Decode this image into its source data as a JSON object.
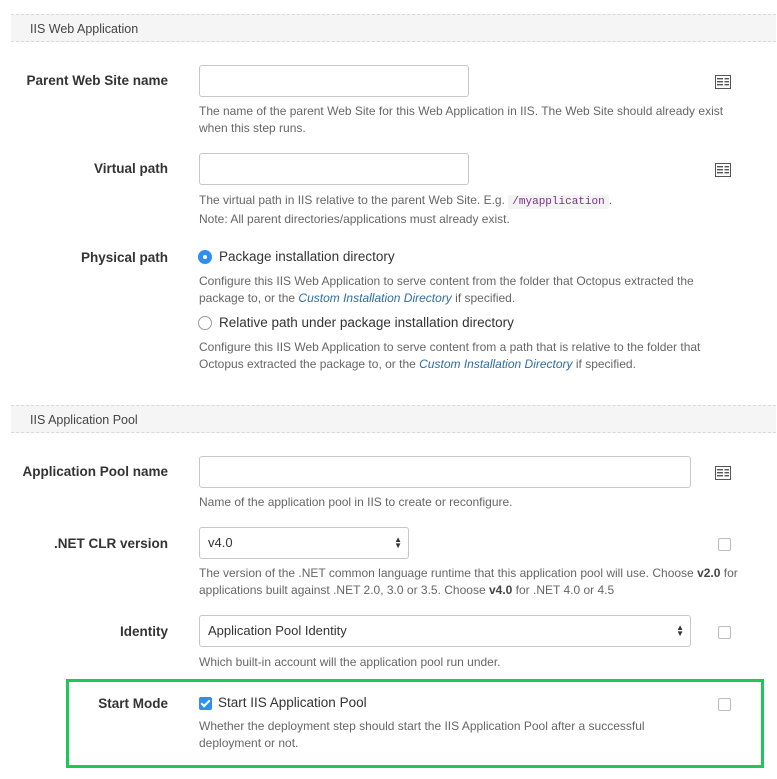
{
  "sections": {
    "web_app": "IIS Web Application",
    "app_pool": "IIS Application Pool"
  },
  "fields": {
    "parent_site": {
      "label": "Parent Web Site name",
      "value": "",
      "help": "The name of the parent Web Site for this Web Application in IIS. The Web Site should already exist when this step runs."
    },
    "virtual_path": {
      "label": "Virtual path",
      "value": "",
      "help_prefix": "The virtual path in IIS relative to the parent Web Site. E.g.",
      "help_code": "/myapplication",
      "help_suffix": ".",
      "help_line2": "Note: All parent directories/applications must already exist."
    },
    "physical_path": {
      "label": "Physical path",
      "option1": {
        "label": "Package installation directory",
        "selected": true,
        "help_prefix": "Configure this IIS Web Application to serve content from the folder that Octopus extracted the package to, or the",
        "help_link": "Custom Installation Directory",
        "help_suffix": "if specified."
      },
      "option2": {
        "label": "Relative path under package installation directory",
        "selected": false,
        "help_prefix": "Configure this IIS Web Application to serve content from a path that is relative to the folder that Octopus extracted the package to, or the",
        "help_link": "Custom Installation Directory",
        "help_suffix": "if specified."
      }
    },
    "app_pool_name": {
      "label": "Application Pool name",
      "value": "",
      "help": "Name of the application pool in IIS to create or reconfigure."
    },
    "clr_version": {
      "label": ".NET CLR version",
      "value": "v4.0",
      "help_a": "The version of the .NET common language runtime that this application pool will use. Choose",
      "help_b1": "v2.0",
      "help_c": "for applications built against .NET 2.0, 3.0 or 3.5. Choose",
      "help_b2": "v4.0",
      "help_d": "for .NET 4.0 or 4.5"
    },
    "identity": {
      "label": "Identity",
      "value": "Application Pool Identity",
      "help": "Which built-in account will the application pool run under."
    },
    "start_mode": {
      "label": "Start Mode",
      "checkbox_label": "Start IIS Application Pool",
      "checked": true,
      "help": "Whether the deployment step should start the IIS Application Pool after a successful deployment or not."
    }
  },
  "colors": {
    "accent": "#2f8ff0",
    "highlight": "#1ec75a",
    "link": "#2e6da4"
  }
}
